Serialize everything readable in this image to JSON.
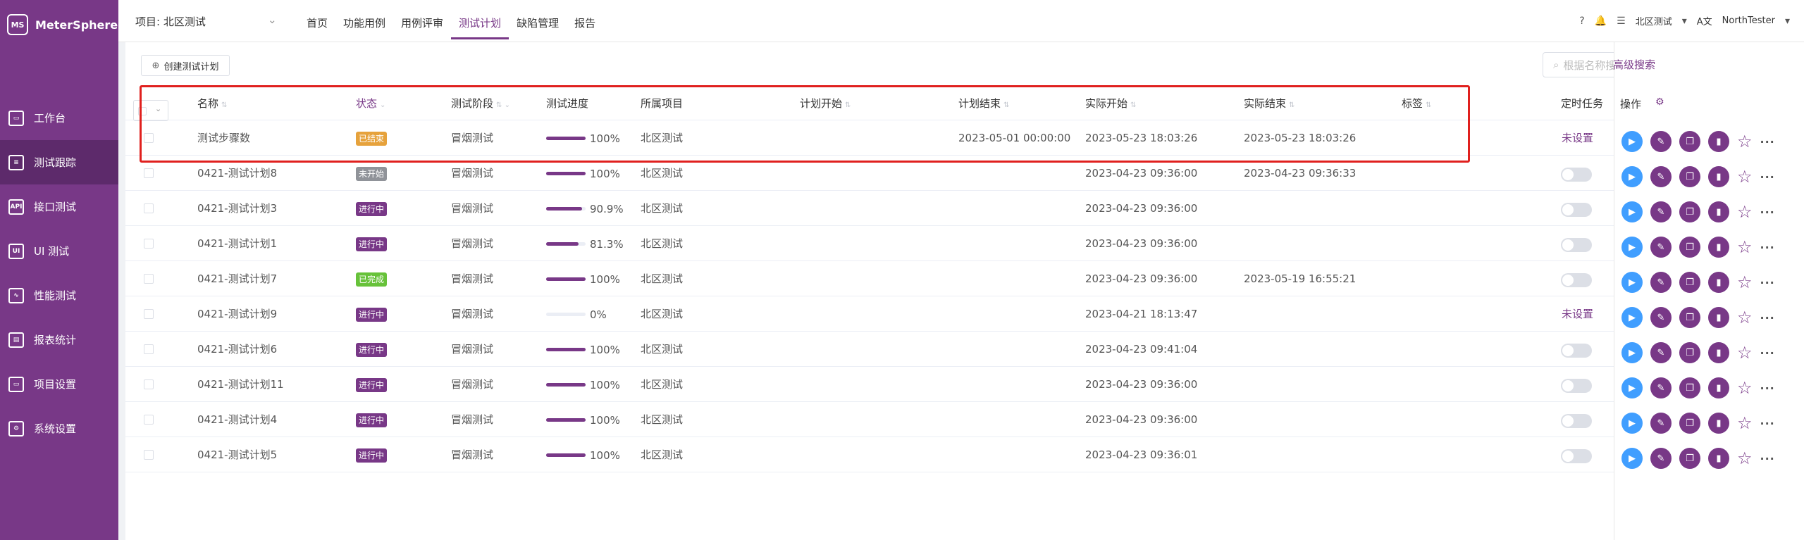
{
  "app": {
    "name": "MeterSphere",
    "logo_mark": "MS"
  },
  "sidebar": {
    "items": [
      {
        "label": "工作台",
        "icon": "monitor-icon"
      },
      {
        "label": "测试跟踪",
        "icon": "clipboard-icon",
        "active": true
      },
      {
        "label": "接口测试",
        "icon": "api-icon"
      },
      {
        "label": "UI 测试",
        "icon": "ui-icon"
      },
      {
        "label": "性能测试",
        "icon": "chart-icon"
      },
      {
        "label": "报表统计",
        "icon": "report-icon"
      },
      {
        "label": "项目设置",
        "icon": "folder-icon"
      },
      {
        "label": "系统设置",
        "icon": "gear-icon"
      }
    ]
  },
  "header": {
    "project": "项目: 北区测试",
    "tabs": [
      "首页",
      "功能用例",
      "用例评审",
      "测试计划",
      "缺陷管理",
      "报告"
    ],
    "active_tab": "测试计划",
    "workspace": "北区测试",
    "language": "A文",
    "user": "NorthTester"
  },
  "toolbar": {
    "create_label": "创建测试计划",
    "search_placeholder": "根据名称搜索",
    "advanced_search": "高级搜索"
  },
  "table": {
    "columns": [
      "名称",
      "状态",
      "测试阶段",
      "测试进度",
      "所属项目",
      "计划开始",
      "计划结束",
      "实际开始",
      "实际结束",
      "标签",
      "定时任务"
    ],
    "ops_header": "操作",
    "rows": [
      {
        "name": "测试步骤数",
        "status": "已结束",
        "status_color": "#e6a23c",
        "stage": "冒烟测试",
        "progress": 100,
        "progress_text": "100%",
        "project": "北区测试",
        "plan_start": "",
        "plan_end": "2023-05-01 00:00:00",
        "actual_start": "2023-05-23 18:03:26",
        "actual_end": "2023-05-23 18:03:26",
        "schedule": "未设置"
      },
      {
        "name": "0421-测试计划8",
        "status": "未开始",
        "status_color": "#909399",
        "stage": "冒烟测试",
        "progress": 100,
        "progress_text": "100%",
        "project": "北区测试",
        "plan_start": "",
        "plan_end": "",
        "actual_start": "2023-04-23 09:36:00",
        "actual_end": "2023-04-23 09:36:33",
        "schedule": ""
      },
      {
        "name": "0421-测试计划3",
        "status": "进行中",
        "status_color": "#783887",
        "stage": "冒烟测试",
        "progress": 90.9,
        "progress_text": "90.9%",
        "project": "北区测试",
        "plan_start": "",
        "plan_end": "",
        "actual_start": "2023-04-23 09:36:00",
        "actual_end": "",
        "schedule": ""
      },
      {
        "name": "0421-测试计划1",
        "status": "进行中",
        "status_color": "#783887",
        "stage": "冒烟测试",
        "progress": 81.3,
        "progress_text": "81.3%",
        "project": "北区测试",
        "plan_start": "",
        "plan_end": "",
        "actual_start": "2023-04-23 09:36:00",
        "actual_end": "",
        "schedule": ""
      },
      {
        "name": "0421-测试计划7",
        "status": "已完成",
        "status_color": "#67c23a",
        "stage": "冒烟测试",
        "progress": 100,
        "progress_text": "100%",
        "project": "北区测试",
        "plan_start": "",
        "plan_end": "",
        "actual_start": "2023-04-23 09:36:00",
        "actual_end": "2023-05-19 16:55:21",
        "schedule": ""
      },
      {
        "name": "0421-测试计划9",
        "status": "进行中",
        "status_color": "#783887",
        "stage": "冒烟测试",
        "progress": 0,
        "progress_text": "0%",
        "project": "北区测试",
        "plan_start": "",
        "plan_end": "",
        "actual_start": "2023-04-21 18:13:47",
        "actual_end": "",
        "schedule": "未设置"
      },
      {
        "name": "0421-测试计划6",
        "status": "进行中",
        "status_color": "#783887",
        "stage": "冒烟测试",
        "progress": 100,
        "progress_text": "100%",
        "project": "北区测试",
        "plan_start": "",
        "plan_end": "",
        "actual_start": "2023-04-23 09:41:04",
        "actual_end": "",
        "schedule": ""
      },
      {
        "name": "0421-测试计划11",
        "status": "进行中",
        "status_color": "#783887",
        "stage": "冒烟测试",
        "progress": 100,
        "progress_text": "100%",
        "project": "北区测试",
        "plan_start": "",
        "plan_end": "",
        "actual_start": "2023-04-23 09:36:00",
        "actual_end": "",
        "schedule": ""
      },
      {
        "name": "0421-测试计划4",
        "status": "进行中",
        "status_color": "#783887",
        "stage": "冒烟测试",
        "progress": 100,
        "progress_text": "100%",
        "project": "北区测试",
        "plan_start": "",
        "plan_end": "",
        "actual_start": "2023-04-23 09:36:00",
        "actual_end": "",
        "schedule": ""
      },
      {
        "name": "0421-测试计划5",
        "status": "进行中",
        "status_color": "#783887",
        "stage": "冒烟测试",
        "progress": 100,
        "progress_text": "100%",
        "project": "北区测试",
        "plan_start": "",
        "plan_end": "",
        "actual_start": "2023-04-23 09:36:01",
        "actual_end": "",
        "schedule": ""
      }
    ]
  },
  "colors": {
    "brand": "#783887",
    "accent_blue": "#409eff",
    "highlight_box": "#e0201e"
  }
}
